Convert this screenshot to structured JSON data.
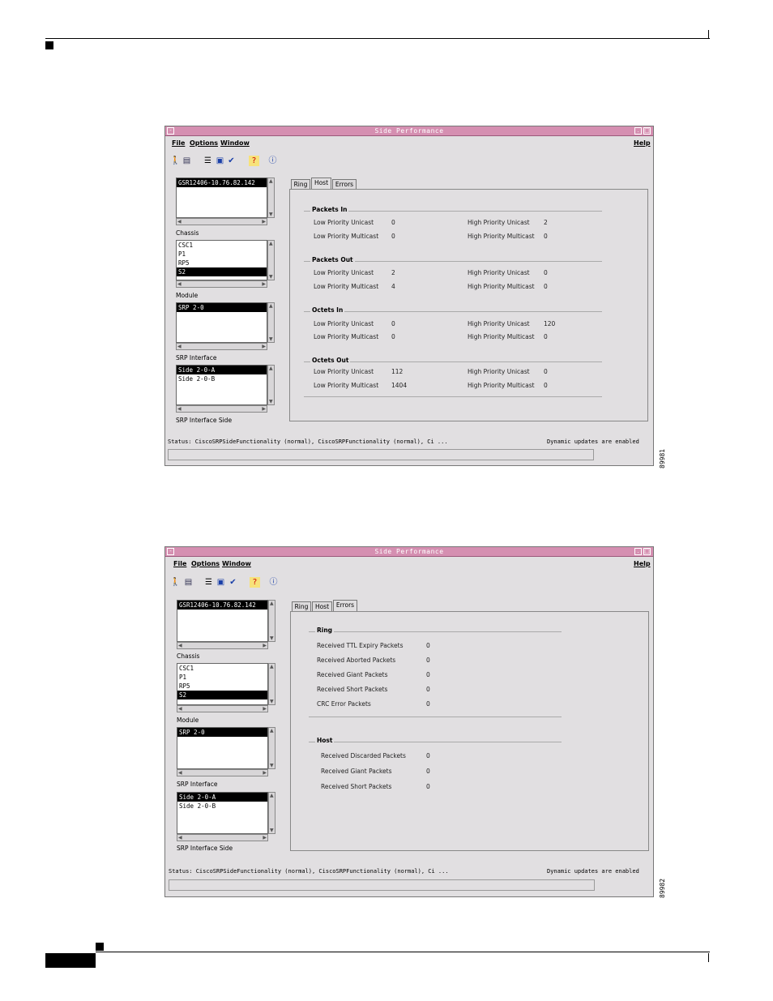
{
  "window_title": "Side Performance",
  "menu": {
    "file": "File",
    "options": "Options",
    "window": "Window",
    "help": "Help"
  },
  "toolbar_icons": [
    "exit-icon",
    "devices-icon",
    "list-icon",
    "monitor-icon",
    "check-icon",
    "help-icon",
    "info-icon"
  ],
  "lists": {
    "devices": [
      "GSR12406-10.76.82.142"
    ],
    "chassis_label": "Chassis",
    "chassis": [
      "CSC1",
      "P1",
      "RP5",
      "S2"
    ],
    "module_label": "Module",
    "modules": [
      "SRP 2-0"
    ],
    "srp_interface_label": "SRP Interface",
    "sides": [
      "Side 2-0-A",
      "Side 2-0-B"
    ],
    "srp_side_label": "SRP Interface Side"
  },
  "tabs": [
    "Ring",
    "Host",
    "Errors"
  ],
  "host_panel": {
    "groups": [
      {
        "title": "Packets In",
        "rows": [
          {
            "l_label": "Low Priority Unicast",
            "l_value": "0",
            "r_label": "High Priority Unicast",
            "r_value": "2"
          },
          {
            "l_label": "Low Priority Multicast",
            "l_value": "0",
            "r_label": "High Priority Multicast",
            "r_value": "0"
          }
        ]
      },
      {
        "title": "Packets Out",
        "rows": [
          {
            "l_label": "Low Priority Unicast",
            "l_value": "2",
            "r_label": "High Priority Unicast",
            "r_value": "0"
          },
          {
            "l_label": "Low Priority Multicast",
            "l_value": "4",
            "r_label": "High Priority Multicast",
            "r_value": "0"
          }
        ]
      },
      {
        "title": "Octets In",
        "rows": [
          {
            "l_label": "Low Priority Unicast",
            "l_value": "0",
            "r_label": "High Priority Unicast",
            "r_value": "120"
          },
          {
            "l_label": "Low Priority Multicast",
            "l_value": "0",
            "r_label": "High Priority Multicast",
            "r_value": "0"
          }
        ]
      },
      {
        "title": "Octets Out",
        "rows": [
          {
            "l_label": "Low Priority Unicast",
            "l_value": "112",
            "r_label": "High Priority Unicast",
            "r_value": "0"
          },
          {
            "l_label": "Low Priority Multicast",
            "l_value": "1404",
            "r_label": "High Priority Multicast",
            "r_value": "0"
          }
        ]
      }
    ]
  },
  "errors_panel": {
    "ring_title": "Ring",
    "ring_rows": [
      {
        "label": "Received TTL Expiry Packets",
        "value": "0"
      },
      {
        "label": "Received Aborted Packets",
        "value": "0"
      },
      {
        "label": "Received Giant Packets",
        "value": "0"
      },
      {
        "label": "Received Short Packets",
        "value": "0"
      },
      {
        "label": "CRC Error Packets",
        "value": "0"
      }
    ],
    "host_title": "Host",
    "host_rows": [
      {
        "label": "Received Discarded Packets",
        "value": "0"
      },
      {
        "label": "Received Giant Packets",
        "value": "0"
      },
      {
        "label": "Received Short Packets",
        "value": "0"
      }
    ]
  },
  "status": {
    "text": "Status: CiscoSRPSideFunctionality (normal), CiscoSRPFunctionality (normal), Ci ...",
    "dynamic": "Dynamic updates are enabled"
  },
  "figure_ids": [
    "89981",
    "89982"
  ]
}
